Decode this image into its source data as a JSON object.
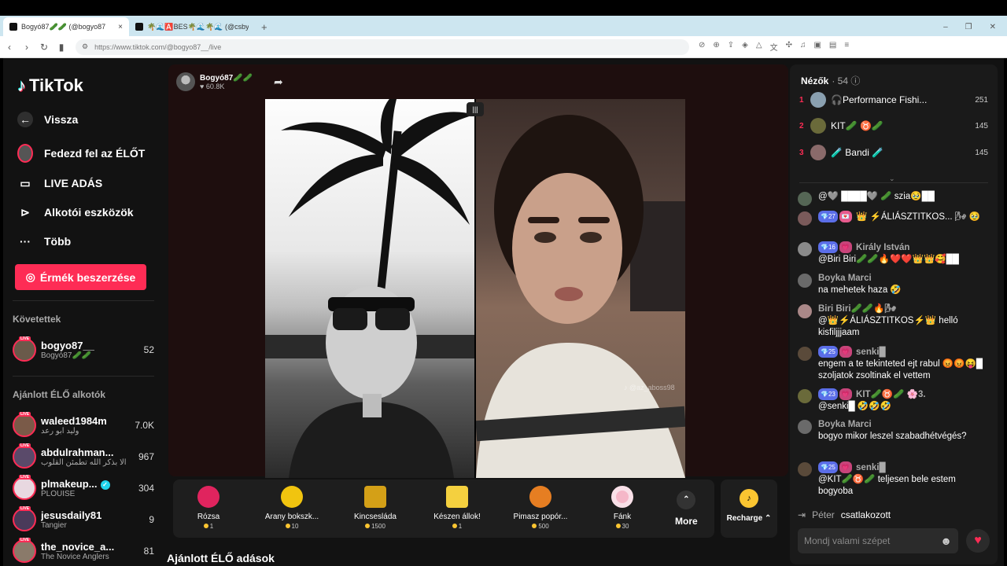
{
  "browser": {
    "tabs": [
      {
        "title": "Bogyó87🥒🥒 (@bogyo87",
        "close": "×"
      },
      {
        "title": "🌴🌊🅰️BES🌴🌊🌴🌊 (@csby01",
        "close": ""
      }
    ],
    "new_tab": "+",
    "window_controls": [
      "–",
      "❐",
      "✕"
    ],
    "url": "https://www.tiktok.com/@bogyo87__/live"
  },
  "sidebar": {
    "logo": "TikTok",
    "nav": [
      {
        "label": "Vissza",
        "icon": "back-arrow-icon"
      },
      {
        "label": "Fedezd fel az ÉLŐT",
        "icon": "live-avatar-icon"
      },
      {
        "label": "LIVE ADÁS",
        "icon": "camera-icon"
      },
      {
        "label": "Alkotói eszközök",
        "icon": "creator-tools-icon"
      },
      {
        "label": "Több",
        "icon": "more-dots-icon"
      }
    ],
    "coins_button": "Érmék beszerzése",
    "following_title": "Követettek",
    "following": [
      {
        "username": "bogyo87__",
        "display": "Bogyó87🥒🥒",
        "count": "52",
        "color": "#6a5a4a"
      }
    ],
    "recommended_title": "Ajánlott ÉLŐ alkotók",
    "recommended": [
      {
        "username": "waleed1984m",
        "display": "وليد ابو رعد",
        "count": "7.0K",
        "color": "#7a5a48",
        "verified": false
      },
      {
        "username": "abdulrahman...",
        "display": "ألا بذكر الله تطمئن القلوب",
        "count": "967",
        "color": "#5a4a6a",
        "verified": false
      },
      {
        "username": "plmakeup...",
        "display": "PLOUISE",
        "count": "304",
        "color": "#e8d8e0",
        "verified": true
      },
      {
        "username": "jesusdaily81",
        "display": "Tangier",
        "count": "9",
        "color": "#4a3a5a",
        "verified": false
      },
      {
        "username": "the_novice_a...",
        "display": "The Novice Anglers",
        "count": "81",
        "color": "#8a7a6a",
        "verified": false
      }
    ]
  },
  "stream": {
    "host_name": "Bogyó87🥒🥒",
    "host_likes": "♥ 60.8K",
    "share_icon": "➦",
    "split_icon": "|||",
    "watermark": "♪ @az_aboss98"
  },
  "gifts": [
    {
      "name": "Rózsa",
      "price": "1",
      "color": "#e0245e"
    },
    {
      "name": "Arany bokszk...",
      "price": "10",
      "color": "#f1c40f"
    },
    {
      "name": "Kincsesláda",
      "price": "1500",
      "color": "#d4a017"
    },
    {
      "name": "Készen állok!",
      "price": "1",
      "color": "#f4d03f"
    },
    {
      "name": "Pimasz popór...",
      "price": "500",
      "color": "#e67e22"
    },
    {
      "name": "Fánk",
      "price": "30",
      "color": "#f5b7c8"
    }
  ],
  "more_label": "More",
  "more_icon": "⌃",
  "recharge_label": "Recharge ⌃",
  "recharge_icon": "♪",
  "suggested_title": "Ajánlott ÉLŐ adások",
  "viewers": {
    "title": "Nézők",
    "count": "· 54 ⓘ",
    "top": [
      {
        "rank": "1",
        "name": "🎧Performance Fishi...",
        "score": "251",
        "color": "#8aa0b0"
      },
      {
        "rank": "2",
        "name": "KIT🥒 ♉🥒",
        "score": "145",
        "color": "#6a6a3a"
      },
      {
        "rank": "3",
        "name": "🧪 Bandi 🧪",
        "score": "145",
        "color": "#8a6a6a"
      }
    ]
  },
  "chat": [
    {
      "badges": [],
      "name": "",
      "text": "@🩶 ████🩶 🥒 szia🥹██",
      "color": "#556655"
    },
    {
      "badges": [
        {
          "t": "💎27",
          "c": "b-blue"
        },
        {
          "t": "💌",
          "c": "b-pink"
        }
      ],
      "name": "",
      "text": "👑 ⚡ÁLIÁSZTITKOS... 🌬 🥹",
      "color": "#7a5a5a"
    },
    {
      "badges": [
        {
          "t": "💎16",
          "c": "b-blue"
        },
        {
          "t": "💗",
          "c": "b-heart"
        }
      ],
      "name": "Király István",
      "text": "@Biri Biri🥒🥒🔥❤️❤️👑👑🥰██",
      "color": "#8a8a8a"
    },
    {
      "badges": [],
      "name": "Boyka Marci",
      "text": "na mehetek haza 🤣",
      "color": "#6a6a6a"
    },
    {
      "badges": [],
      "name": "Biri Biri🥒🥒🔥🌬",
      "text": "@👑⚡ÁLIÁSZTITKOS⚡👑 helló kisfiljjjaam",
      "color": "#aa8888"
    },
    {
      "badges": [
        {
          "t": "💎25",
          "c": "b-blue"
        },
        {
          "t": "💗",
          "c": "b-heart"
        }
      ],
      "name": "senki█",
      "text": "engem a te tekinteted ejt rabul 😡😡😝█ szoljatok zsoltinak el vettem",
      "color": "#5a4a3a"
    },
    {
      "badges": [
        {
          "t": "💎23",
          "c": "b-blue"
        },
        {
          "t": "💗",
          "c": "b-heart"
        }
      ],
      "name": "KIT🥒♉🥒 🌸3.",
      "text": "@senki█ 🤣🤣🤣",
      "color": "#6a6a3a"
    },
    {
      "badges": [],
      "name": "Boyka Marci",
      "text": "bogyo mikor leszel szabadhétvégés?",
      "color": "#6a6a6a"
    },
    {
      "badges": [
        {
          "t": "💎25",
          "c": "b-blue"
        },
        {
          "t": "💗",
          "c": "b-heart"
        }
      ],
      "name": "senki█",
      "text": "@KIT🥒♉🥒 teljesen bele estem bogyoba",
      "color": "#5a4a3a"
    }
  ],
  "joined": {
    "name": "Péter",
    "action": "csatlakozott"
  },
  "input_placeholder": "Mondj valami szépet",
  "emoji_icon": "☻",
  "heart_icon": "♥"
}
